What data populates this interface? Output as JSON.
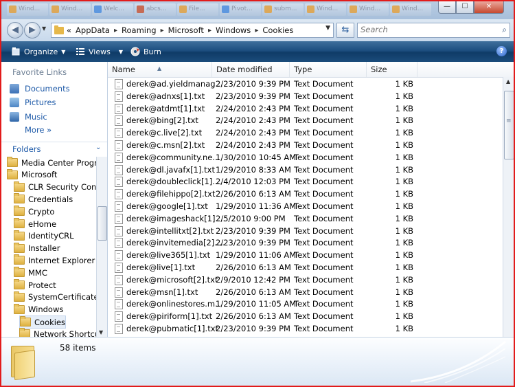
{
  "taskbar": {
    "tabs": [
      "Wind...",
      "Wind...",
      "Welc...",
      "abcs...",
      "File...",
      "Pivot...",
      "subm...",
      "Wind...",
      "Wind...",
      "Wind..."
    ]
  },
  "window_buttons": {
    "minimize": "—",
    "maximize": "☐",
    "close": "✕"
  },
  "address": {
    "prefix": "«",
    "crumbs": [
      "AppData",
      "Roaming",
      "Microsoft",
      "Windows",
      "Cookies"
    ]
  },
  "search": {
    "placeholder": "Search"
  },
  "toolbar": {
    "organize": "Organize",
    "views": "Views",
    "burn": "Burn",
    "help": "?"
  },
  "nav": {
    "favorite_links_title": "Favorite Links",
    "favorites": [
      "Documents",
      "Pictures",
      "Music"
    ],
    "more": "More",
    "folders_title": "Folders",
    "tree": [
      {
        "label": "Media Center Programs",
        "indent": 0
      },
      {
        "label": "Microsoft",
        "indent": 0
      },
      {
        "label": "CLR Security Config",
        "indent": 1
      },
      {
        "label": "Credentials",
        "indent": 1
      },
      {
        "label": "Crypto",
        "indent": 1
      },
      {
        "label": "eHome",
        "indent": 1
      },
      {
        "label": "IdentityCRL",
        "indent": 1
      },
      {
        "label": "Installer",
        "indent": 1
      },
      {
        "label": "Internet Explorer",
        "indent": 1
      },
      {
        "label": "MMC",
        "indent": 1
      },
      {
        "label": "Protect",
        "indent": 1
      },
      {
        "label": "SystemCertificates",
        "indent": 1
      },
      {
        "label": "Windows",
        "indent": 1
      },
      {
        "label": "Cookies",
        "indent": 2,
        "selected": true
      },
      {
        "label": "Network Shortcuts",
        "indent": 2
      }
    ]
  },
  "columns": {
    "name": "Name",
    "date": "Date modified",
    "type": "Type",
    "size": "Size"
  },
  "files": [
    {
      "name": "derek@ad.yieldmanag...",
      "date": "2/23/2010 9:39 PM",
      "type": "Text Document",
      "size": "1 KB"
    },
    {
      "name": "derek@adnxs[1].txt",
      "date": "2/23/2010 9:39 PM",
      "type": "Text Document",
      "size": "1 KB"
    },
    {
      "name": "derek@atdmt[1].txt",
      "date": "2/24/2010 2:43 PM",
      "type": "Text Document",
      "size": "1 KB"
    },
    {
      "name": "derek@bing[2].txt",
      "date": "2/24/2010 2:43 PM",
      "type": "Text Document",
      "size": "1 KB"
    },
    {
      "name": "derek@c.live[2].txt",
      "date": "2/24/2010 2:43 PM",
      "type": "Text Document",
      "size": "1 KB"
    },
    {
      "name": "derek@c.msn[2].txt",
      "date": "2/24/2010 2:43 PM",
      "type": "Text Document",
      "size": "1 KB"
    },
    {
      "name": "derek@community.ne...",
      "date": "1/30/2010 10:45 AM",
      "type": "Text Document",
      "size": "1 KB"
    },
    {
      "name": "derek@dl.javafx[1].txt",
      "date": "1/29/2010 8:33 AM",
      "type": "Text Document",
      "size": "1 KB"
    },
    {
      "name": "derek@doubleclick[1]....",
      "date": "2/4/2010 12:03 PM",
      "type": "Text Document",
      "size": "1 KB"
    },
    {
      "name": "derek@filehippo[2].txt",
      "date": "2/26/2010 6:13 AM",
      "type": "Text Document",
      "size": "1 KB"
    },
    {
      "name": "derek@google[1].txt",
      "date": "1/29/2010 11:36 AM",
      "type": "Text Document",
      "size": "1 KB"
    },
    {
      "name": "derek@imageshack[1]....",
      "date": "2/5/2010 9:00 PM",
      "type": "Text Document",
      "size": "1 KB"
    },
    {
      "name": "derek@intellitxt[2].txt",
      "date": "2/23/2010 9:39 PM",
      "type": "Text Document",
      "size": "1 KB"
    },
    {
      "name": "derek@invitemedia[2]....",
      "date": "2/23/2010 9:39 PM",
      "type": "Text Document",
      "size": "1 KB"
    },
    {
      "name": "derek@live365[1].txt",
      "date": "1/29/2010 11:06 AM",
      "type": "Text Document",
      "size": "1 KB"
    },
    {
      "name": "derek@live[1].txt",
      "date": "2/26/2010 6:13 AM",
      "type": "Text Document",
      "size": "1 KB"
    },
    {
      "name": "derek@microsoft[2].txt",
      "date": "2/9/2010 12:42 PM",
      "type": "Text Document",
      "size": "1 KB"
    },
    {
      "name": "derek@msn[1].txt",
      "date": "2/26/2010 6:13 AM",
      "type": "Text Document",
      "size": "1 KB"
    },
    {
      "name": "derek@onlinestores.m...",
      "date": "1/29/2010 11:05 AM",
      "type": "Text Document",
      "size": "1 KB"
    },
    {
      "name": "derek@piriform[1].txt",
      "date": "2/26/2010 6:13 AM",
      "type": "Text Document",
      "size": "1 KB"
    },
    {
      "name": "derek@pubmatic[1].txt",
      "date": "2/23/2010 9:39 PM",
      "type": "Text Document",
      "size": "1 KB"
    }
  ],
  "details": {
    "item_count": "58 items"
  },
  "colors": {
    "frame_border": "#e21b1b",
    "toolbar": "#1d4f80",
    "link": "#1e5aa8"
  },
  "icons": {
    "nav_back": "back-arrow-icon",
    "nav_forward": "forward-arrow-icon",
    "search": "magnifier-icon",
    "refresh": "refresh-icon"
  }
}
